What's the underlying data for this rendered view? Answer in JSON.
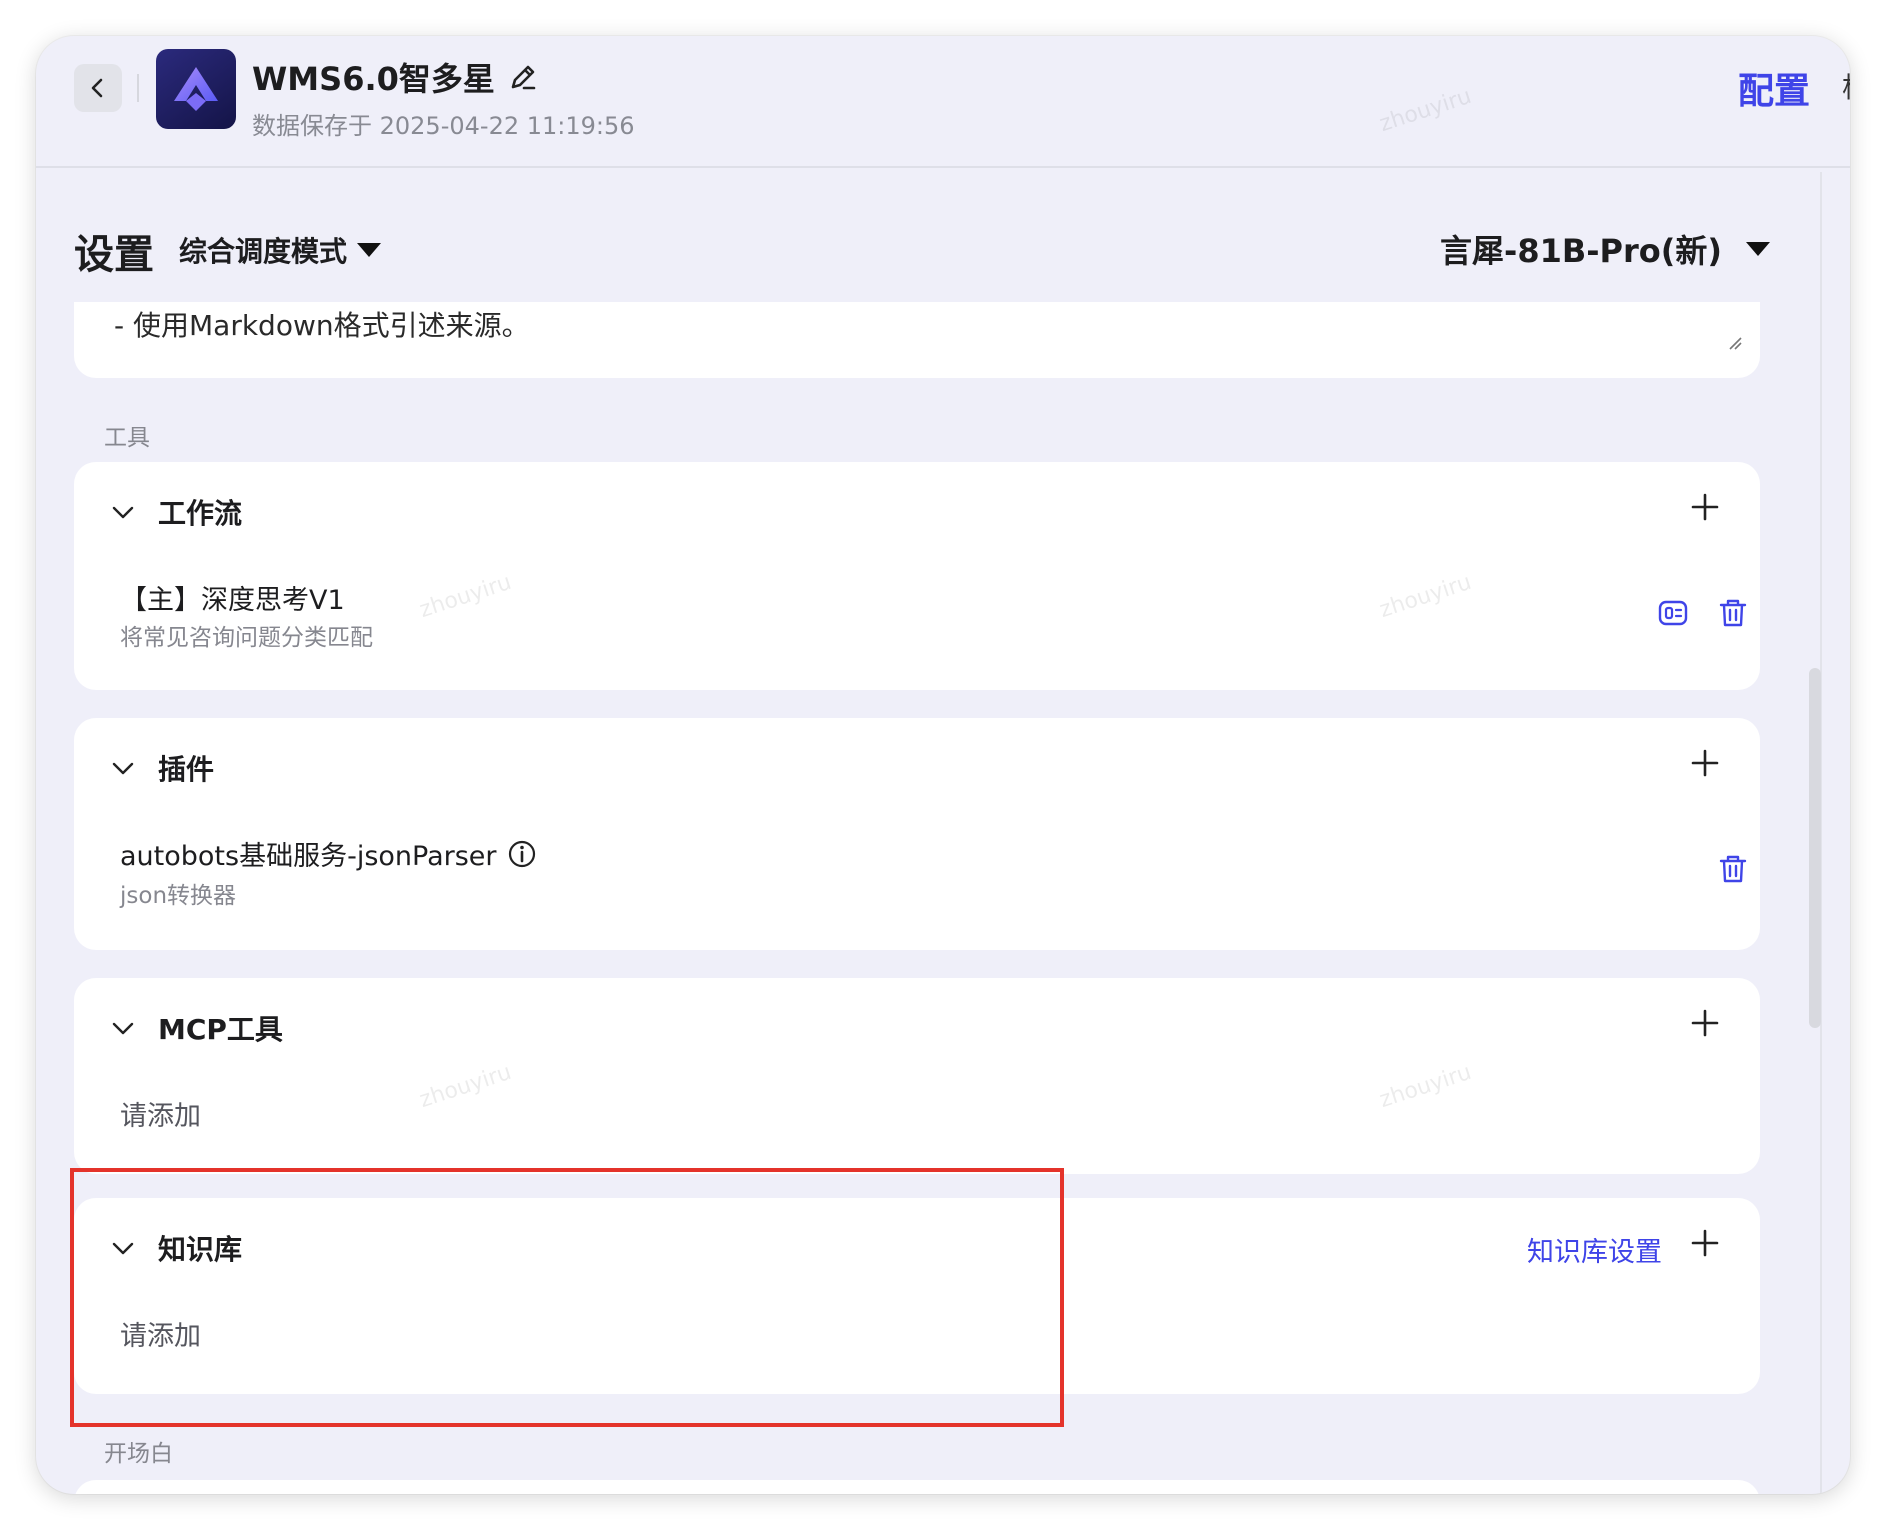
{
  "header": {
    "app_title": "WMS6.0智多星",
    "saved_time": "数据保存于 2025-04-22 11:19:56",
    "config_link": "配置",
    "edge_char": "构"
  },
  "settings": {
    "title": "设置",
    "mode": "综合调度模式",
    "model": "言犀-81B-Pro(新)"
  },
  "prompt": {
    "text": "- 使用Markdown格式引述来源。"
  },
  "sections": {
    "tools_label": "工具",
    "opening_label": "开场白"
  },
  "workflow": {
    "title": "工作流",
    "item_title": "【主】深度思考V1",
    "item_desc": "将常见咨询问题分类匹配"
  },
  "plugins": {
    "title": "插件",
    "item_title": "autobots基础服务-jsonParser",
    "item_desc": "json转换器"
  },
  "mcp": {
    "title": "MCP工具",
    "empty": "请添加"
  },
  "knowledge": {
    "title": "知识库",
    "settings_link": "知识库设置",
    "empty": "请添加"
  },
  "watermark_text": "zhouyiru",
  "colors": {
    "accent": "#3f44e8",
    "highlight": "#e4332b",
    "background": "#efeff9"
  }
}
